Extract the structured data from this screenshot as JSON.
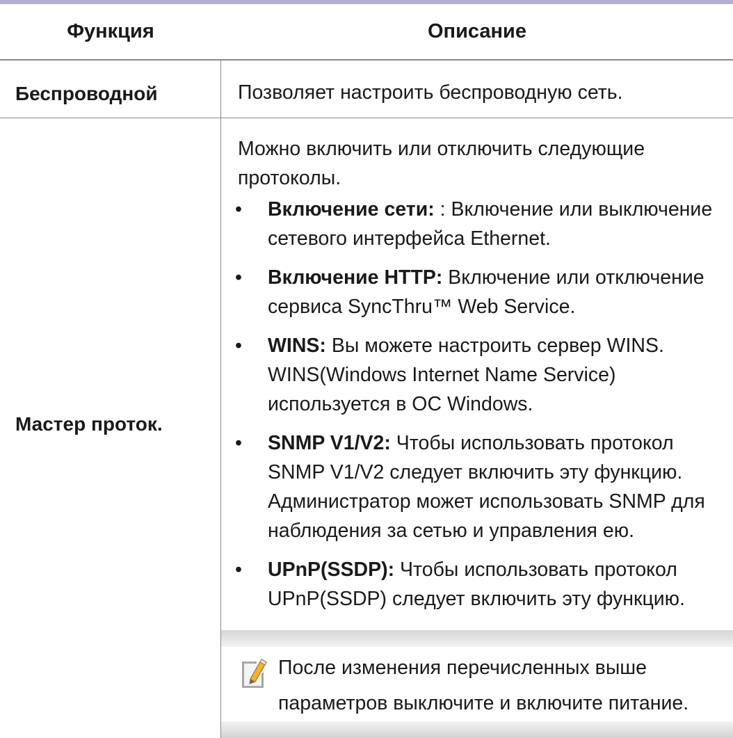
{
  "table": {
    "headers": {
      "function": "Функция",
      "description": "Описание"
    },
    "rows": [
      {
        "function": "Беспроводной",
        "description": "Позволяет настроить беспроводную сеть."
      },
      {
        "function": "Мастер проток.",
        "intro": "Можно включить или отключить следующие протоколы.",
        "bullets": [
          {
            "term": "Включение сети:",
            "text": " : Включение или выключение сетевого интерфейса Ethernet."
          },
          {
            "term": "Включение HTTP:",
            "text": " Включение или отключение сервиса SyncThru™ Web Service."
          },
          {
            "term": "WINS:",
            "text": " Вы можете настроить сервер WINS. WINS(Windows Internet Name Service) используется в ОС Windows."
          },
          {
            "term": "SNMP V1/V2:",
            "text": " Чтобы использовать протокол SNMP V1/V2 следует включить эту функцию. Администратор может использовать SNMP для наблюдения за сетью и управления ею."
          },
          {
            "term": "UPnP(SSDP):",
            "text": " Чтобы использовать протокол UPnP(SSDP) следует включить эту функцию."
          }
        ],
        "note": {
          "icon": "note-pencil-icon",
          "text": "После изменения перечисленных выше параметров выключите и включите питание."
        }
      }
    ]
  },
  "colors": {
    "top_rule": "#b3afd4",
    "note_pencil": "#f2b233"
  }
}
